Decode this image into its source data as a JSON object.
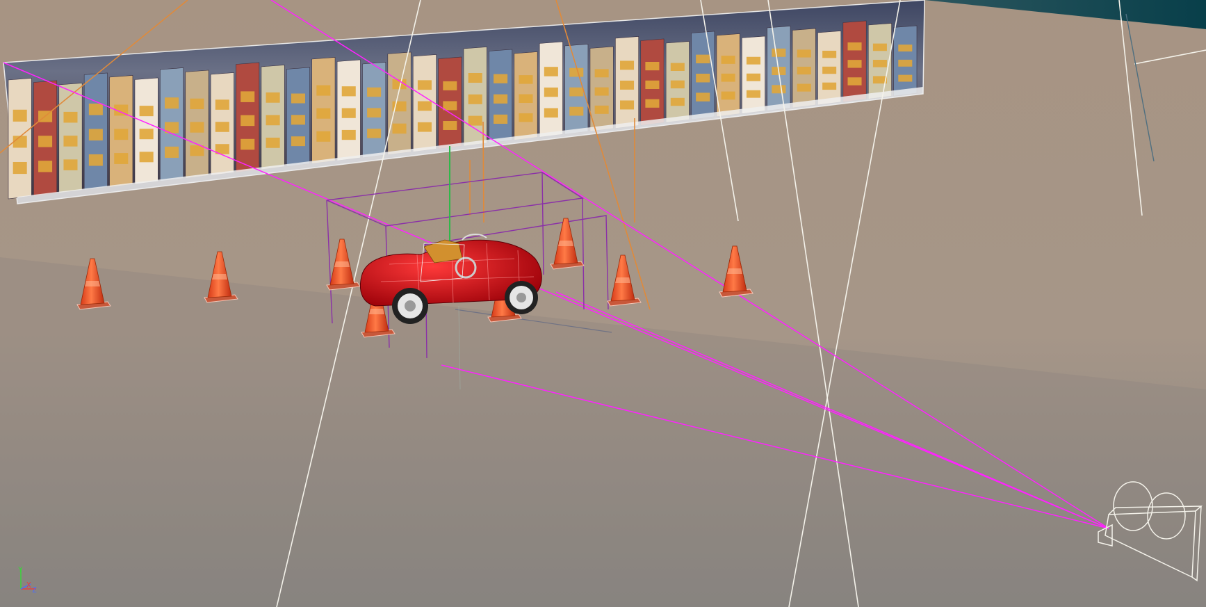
{
  "viewport": {
    "name": "3d-perspective-viewport",
    "sky_color": "#0c4450",
    "ground_color_far": "#a69587",
    "ground_color_near": "#8a847f",
    "gizmo_color": "#ff00ff",
    "wire_white": "#f4f2ea",
    "cone_color": "#ff5a2a",
    "car_color": "#c81018"
  },
  "scene_objects": [
    {
      "name": "town-backdrop-plane",
      "kind": "textured-plane"
    },
    {
      "name": "red-roadster-car",
      "kind": "mesh"
    },
    {
      "name": "traffic-cone",
      "kind": "mesh",
      "count": 9
    },
    {
      "name": "scene-camera",
      "kind": "camera"
    }
  ],
  "axis_gizmo": {
    "y": "Y",
    "x": "X",
    "z": "Z",
    "y_color": "#3cd23c",
    "x_color": "#e24040",
    "z_color": "#4a6cff"
  }
}
